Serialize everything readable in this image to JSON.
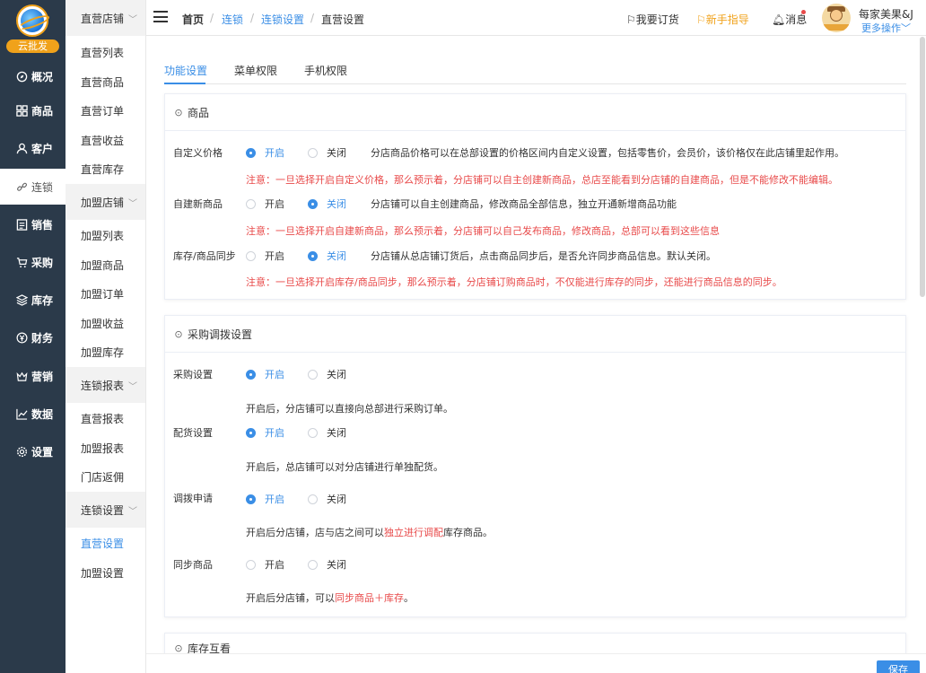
{
  "brand": {
    "badge": "云批发"
  },
  "sidebar": {
    "items": [
      {
        "label": "概况",
        "icon": "compass-icon"
      },
      {
        "label": "商品",
        "icon": "grid-icon"
      },
      {
        "label": "客户",
        "icon": "user-icon"
      },
      {
        "label": "连锁",
        "icon": "link-icon"
      },
      {
        "label": "销售",
        "icon": "list-icon"
      },
      {
        "label": "采购",
        "icon": "cart-icon"
      },
      {
        "label": "库存",
        "icon": "layers-icon"
      },
      {
        "label": "财务",
        "icon": "yen-icon"
      },
      {
        "label": "营销",
        "icon": "crown-icon"
      },
      {
        "label": "数据",
        "icon": "chart-icon"
      },
      {
        "label": "设置",
        "icon": "gear-icon"
      }
    ]
  },
  "subnav": {
    "groups": [
      {
        "title": "直营店铺",
        "items": [
          "直营列表",
          "直营商品",
          "直营订单",
          "直营收益",
          "直营库存"
        ]
      },
      {
        "title": "加盟店铺",
        "items": [
          "加盟列表",
          "加盟商品",
          "加盟订单",
          "加盟收益",
          "加盟库存"
        ]
      },
      {
        "title": "连锁报表",
        "items": [
          "直营报表",
          "加盟报表",
          "门店返佣"
        ]
      },
      {
        "title": "连锁设置",
        "items": [
          "直营设置",
          "加盟设置"
        ]
      }
    ]
  },
  "header": {
    "breadcrumb": [
      "首页",
      "连锁",
      "连锁设置",
      "直营设置"
    ],
    "order_link": "我要订货",
    "guide_link": "新手指导",
    "message": "消息",
    "shop_name": "每家美果&J",
    "more_ops": "更多操作"
  },
  "tabs": [
    "功能设置",
    "菜单权限",
    "手机权限"
  ],
  "options": {
    "on": "开启",
    "off": "关闭"
  },
  "sections": {
    "goods": {
      "title": "商品",
      "rows": [
        {
          "label": "自定义价格",
          "state": "on",
          "desc": "分店商品价格可以在总部设置的价格区间内自定义设置，包括零售价，会员价，该价格仅在此店铺里起作用。",
          "warn": "注意：一旦选择开启自定义价格，那么预示着，分店铺可以自主创建新商品，总店至能看到分店铺的自建商品，但是不能修改不能编辑。"
        },
        {
          "label": "自建新商品",
          "state": "off",
          "desc": "分店铺可以自主创建商品，修改商品全部信息，独立开通新增商品功能",
          "warn": "注意：一旦选择开启自建新商品，那么预示着，分店铺可以自己发布商品，修改商品，总部可以看到这些信息"
        },
        {
          "label": "库存/商品同步",
          "state": "off",
          "desc": "分店铺从总店铺订货后，点击商品同步后，是否允许同步商品信息。默认关闭。",
          "warn": "注意：一旦选择开启库存/商品同步，那么预示着，分店铺订购商品时，不仅能进行库存的同步，还能进行商品信息的同步。"
        }
      ]
    },
    "purchase": {
      "title": "采购调拨设置",
      "rows": [
        {
          "label": "采购设置",
          "state": "on",
          "desc": "开启后，分店铺可以直接向总部进行采购订单。"
        },
        {
          "label": "配货设置",
          "state": "on",
          "desc": "开启后，总店铺可以对分店铺进行单独配货。"
        },
        {
          "label": "调拨申请",
          "state": "on",
          "desc_pre": "开启后分店铺，店与店之间可以",
          "desc_hl": "独立进行调配",
          "desc_post": "库存商品。"
        },
        {
          "label": "同步商品",
          "state": "off",
          "desc_pre": "开启后分店铺，可以",
          "desc_hl": "同步商品＋库存",
          "desc_post": "。"
        }
      ]
    },
    "stock": {
      "title": "库存互看"
    }
  },
  "save_label": "保存",
  "colors": {
    "primary": "#3a8ee6",
    "sidebar": "#2b3a4a",
    "warn": "#e84a4a",
    "accent": "#f0a21b"
  }
}
